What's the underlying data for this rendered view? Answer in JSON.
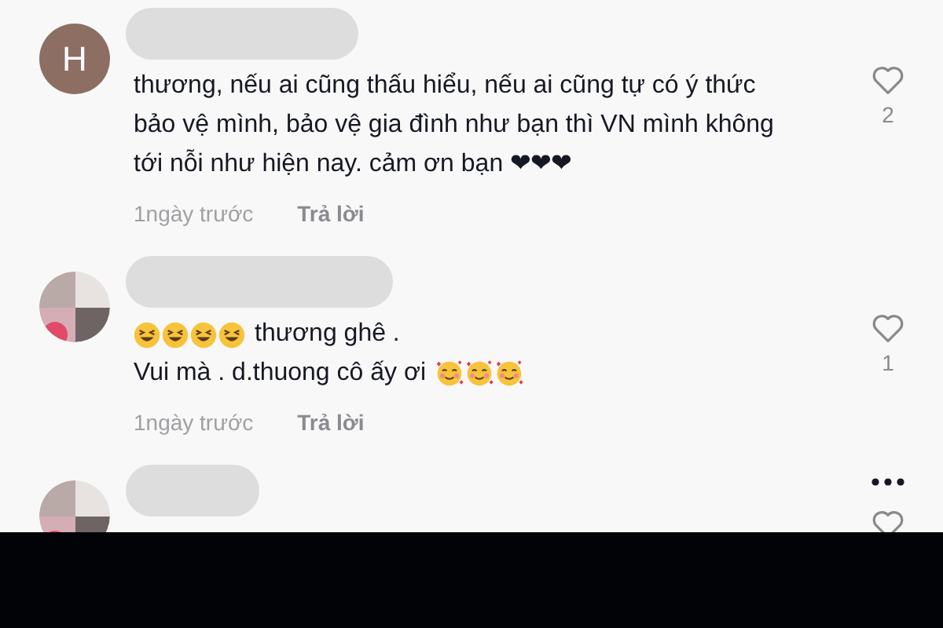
{
  "comments": [
    {
      "avatar": {
        "kind": "letter",
        "letter": "H"
      },
      "lines": [
        [
          {
            "kind": "text",
            "text": "thương, nếu ai cũng thấu hiểu, nếu ai cũng tự có ý thức"
          }
        ],
        [
          {
            "kind": "text",
            "text": "bảo vệ mình, bảo vệ gia đình như bạn thì VN mình không"
          }
        ],
        [
          {
            "kind": "text",
            "text": "tới nỗi như hiện nay. cảm ơn bạn ❤❤❤"
          }
        ]
      ],
      "time": "1ngày trước",
      "reply": "Trả lời",
      "likes": "2",
      "more_menu": false
    },
    {
      "avatar": {
        "kind": "picture"
      },
      "lines": [
        [
          {
            "kind": "laughing"
          },
          {
            "kind": "laughing"
          },
          {
            "kind": "laughing"
          },
          {
            "kind": "laughing"
          },
          {
            "kind": "text",
            "text": "thương ghê ."
          }
        ],
        [
          {
            "kind": "text",
            "text": "Vui mà . d.thuong cô ấy ơi"
          },
          {
            "kind": "hearts"
          },
          {
            "kind": "hearts"
          },
          {
            "kind": "hearts"
          }
        ]
      ],
      "time": "1ngày trước",
      "reply": "Trả lời",
      "likes": "1",
      "more_menu": false
    },
    {
      "avatar": {
        "kind": "picture"
      },
      "more_menu": true
    }
  ]
}
